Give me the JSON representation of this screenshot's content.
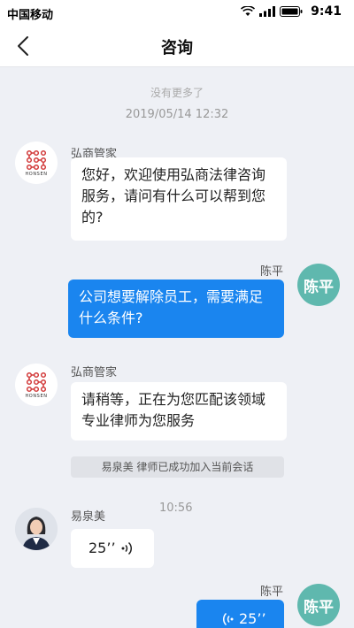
{
  "status_bar": {
    "carrier": "中国移动",
    "time": "9:41"
  },
  "nav": {
    "title": "咨询"
  },
  "chat": {
    "no_more": "没有更多了",
    "timestamp": "2019/05/14  12:32",
    "messages": [
      {
        "sender": "弘商管家",
        "text": "您好，欢迎使用弘商法律咨询服务，请问有什么可以帮到您的?"
      },
      {
        "sender": "陈平",
        "avatar_text": "陈平",
        "text": "公司想要解除员工，需要满足什么条件?"
      },
      {
        "sender": "弘商管家",
        "text": "请稍等，正在为您匹配该领域专业律师为您服务"
      },
      {
        "notice": "易泉美  律师已成功加入当前会话"
      },
      {
        "sender": "易泉美",
        "time": "10:56",
        "voice_duration": "25’’"
      },
      {
        "sender": "陈平",
        "avatar_text": "陈平",
        "voice_duration": "25’’"
      }
    ]
  },
  "logo": {
    "text": "HONSEN"
  },
  "colors": {
    "accent": "#1a85ef",
    "avatar_teal": "#5fb8ae",
    "logo_red": "#d23a3a"
  }
}
